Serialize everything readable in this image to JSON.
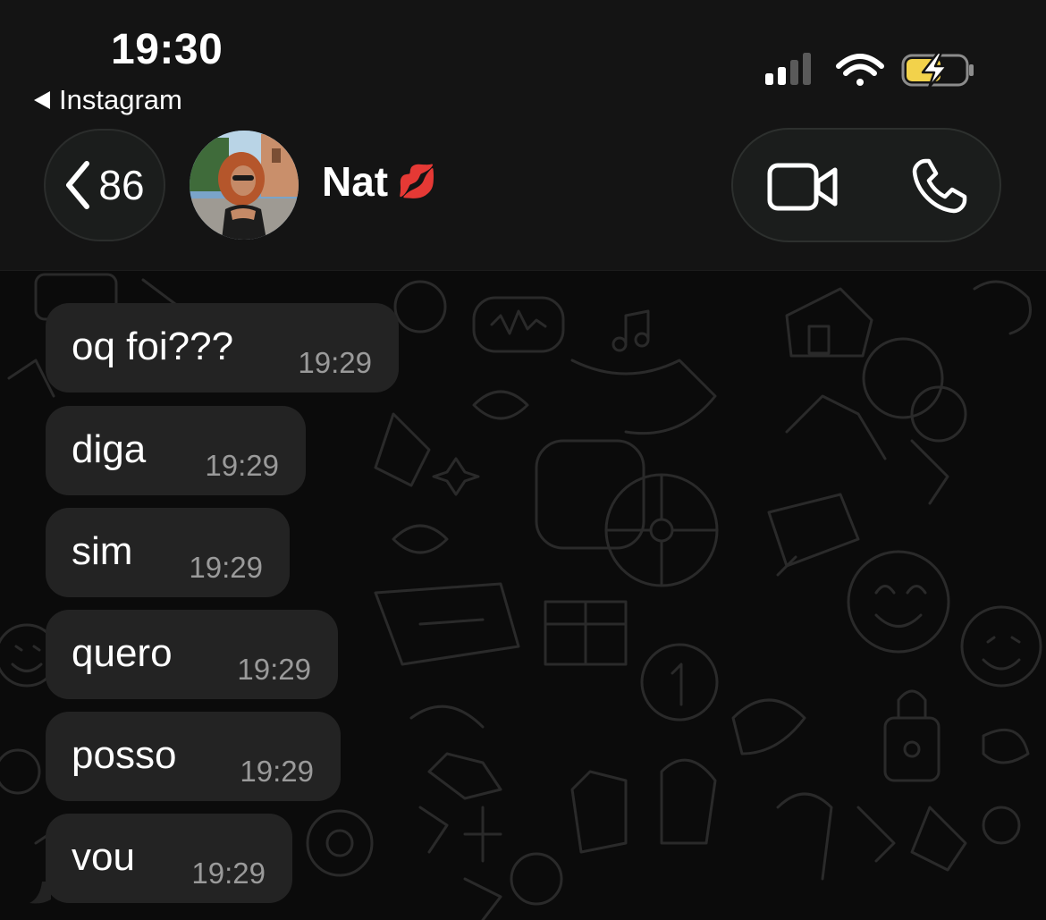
{
  "status_bar": {
    "time": "19:30",
    "back_app": "Instagram",
    "signal_icon": "cellular-signal-icon",
    "wifi_icon": "wifi-icon",
    "battery_icon": "battery-charging-icon",
    "battery_color": "#f2d24b"
  },
  "header": {
    "unread_count": "86",
    "contact_name": "Nat",
    "contact_emoji": "💋",
    "back_icon": "chevron-left-icon",
    "video_icon": "video-camera-icon",
    "phone_icon": "phone-icon"
  },
  "messages": [
    {
      "text": "oq foi???",
      "time": "19:29"
    },
    {
      "text": "diga",
      "time": "19:29"
    },
    {
      "text": "sim",
      "time": "19:29"
    },
    {
      "text": "quero",
      "time": "19:29"
    },
    {
      "text": "posso",
      "time": "19:29"
    },
    {
      "text": "vou",
      "time": "19:29"
    }
  ],
  "colors": {
    "background": "#0b0b0b",
    "header": "#141414",
    "bubble": "#232323",
    "timestamp": "#9a9a9a",
    "doodle": "#2a2a2a"
  }
}
